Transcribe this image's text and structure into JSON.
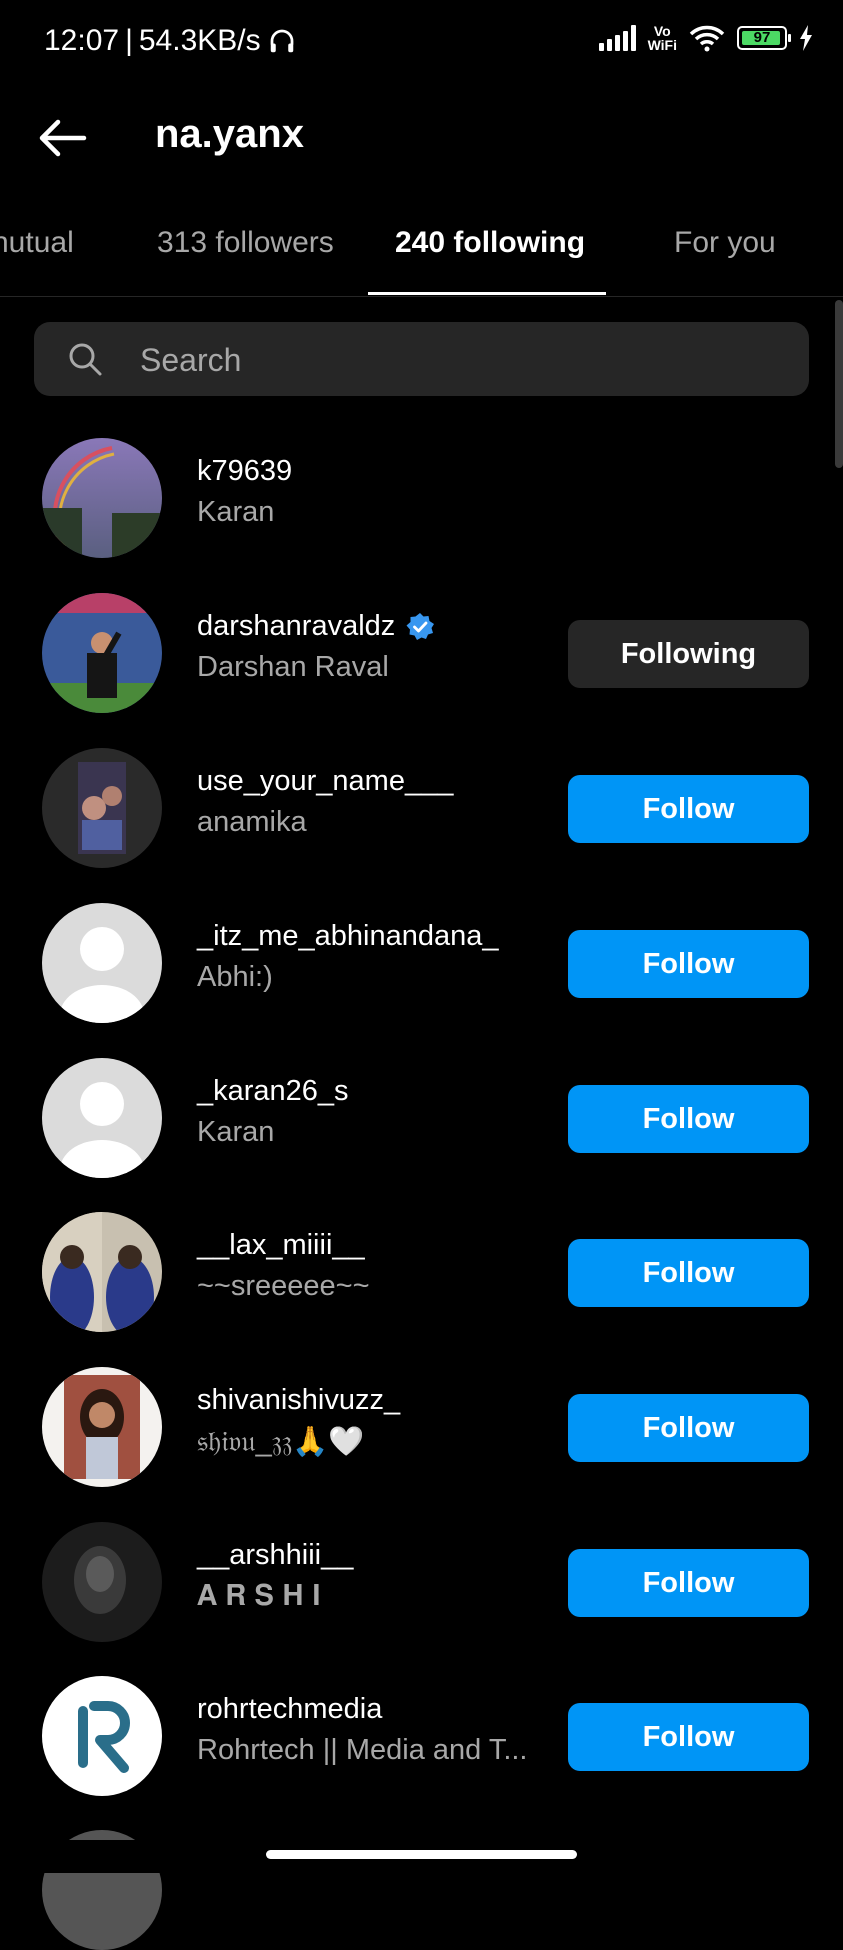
{
  "status_bar": {
    "time": "12:07",
    "net_speed": "54.3KB/s",
    "vowifi_top": "Vo",
    "vowifi_bottom": "WiFi",
    "battery": "97"
  },
  "header": {
    "title": "na.yanx"
  },
  "tabs": [
    {
      "label": "nutual"
    },
    {
      "label": "313 followers"
    },
    {
      "label": "240 following"
    },
    {
      "label": "For you"
    }
  ],
  "search": {
    "placeholder": "Search"
  },
  "users": [
    {
      "username": "k79639",
      "fullname": "Karan",
      "button": "",
      "verified": false,
      "avatar": "photo-rainbow"
    },
    {
      "username": "darshanravaldz",
      "fullname": "Darshan Raval",
      "button": "Following",
      "verified": true,
      "avatar": "photo-stadium"
    },
    {
      "username": "use_your_name___",
      "fullname": "anamika",
      "button": "Follow",
      "verified": false,
      "avatar": "photo-selfie"
    },
    {
      "username": "_itz_me_abhinandana_",
      "fullname": "Abhi:)",
      "button": "Follow",
      "verified": false,
      "avatar": "default-avatar"
    },
    {
      "username": "_karan26_s",
      "fullname": "Karan",
      "button": "Follow",
      "verified": false,
      "avatar": "default-avatar"
    },
    {
      "username": "__lax_miiii__",
      "fullname": "~~sreeeee~~",
      "button": "Follow",
      "verified": false,
      "avatar": "photo-group"
    },
    {
      "username": "shivanishivuzz_",
      "fullname": "𝔰𝔥𝔦𝔳𝔲_𝔷𝔷🙏🤍",
      "button": "Follow",
      "verified": false,
      "avatar": "photo-portrait"
    },
    {
      "username": "__arshhiii__",
      "fullname": "𝐀 𝐑 𝐒 𝐇 𝐈",
      "button": "Follow",
      "verified": false,
      "avatar": "photo-dark"
    },
    {
      "username": "rohrtechmedia",
      "fullname": "Rohrtech || Media and T...",
      "button": "Follow",
      "verified": false,
      "avatar": "logo-r"
    }
  ],
  "colors": {
    "accent": "#0095f6",
    "secondary_button": "#262626",
    "muted_text": "#a8a8a8"
  }
}
